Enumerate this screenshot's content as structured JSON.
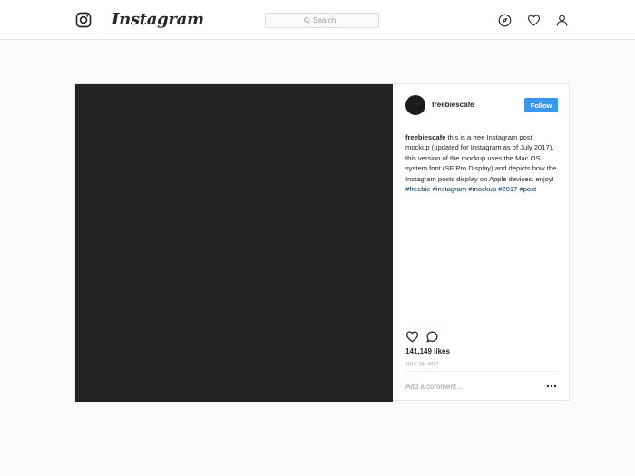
{
  "header": {
    "wordmark": "Instagram",
    "search_placeholder": "Search",
    "icons": [
      "instagram-logo-icon",
      "search-icon",
      "compass-icon",
      "heart-icon",
      "user-icon"
    ]
  },
  "post": {
    "username": "freebiescafe",
    "follow_label": "Follow",
    "caption": {
      "username": "freebiescafe",
      "text": " this is a free Instagram post mockup (updated for Instagram as of July 2017). this version of the mockup uses the Mac OS system font (SF Pro Display) and depicts how the Instagram posts display on Apple devices. enjoy! ",
      "hashtags": [
        "#freebie",
        "#instagram",
        "#mockup",
        "#2017",
        "#post"
      ]
    },
    "likes": "141,149 likes",
    "date": "JULY 19, 2017",
    "comment_placeholder": "Add a comment...",
    "action_icons": [
      "heart-icon",
      "comment-icon",
      "more-icon"
    ]
  },
  "colors": {
    "accent": "#3897f0",
    "hashtag": "#003569",
    "media_placeholder": "#242424",
    "background": "#fafafa"
  }
}
